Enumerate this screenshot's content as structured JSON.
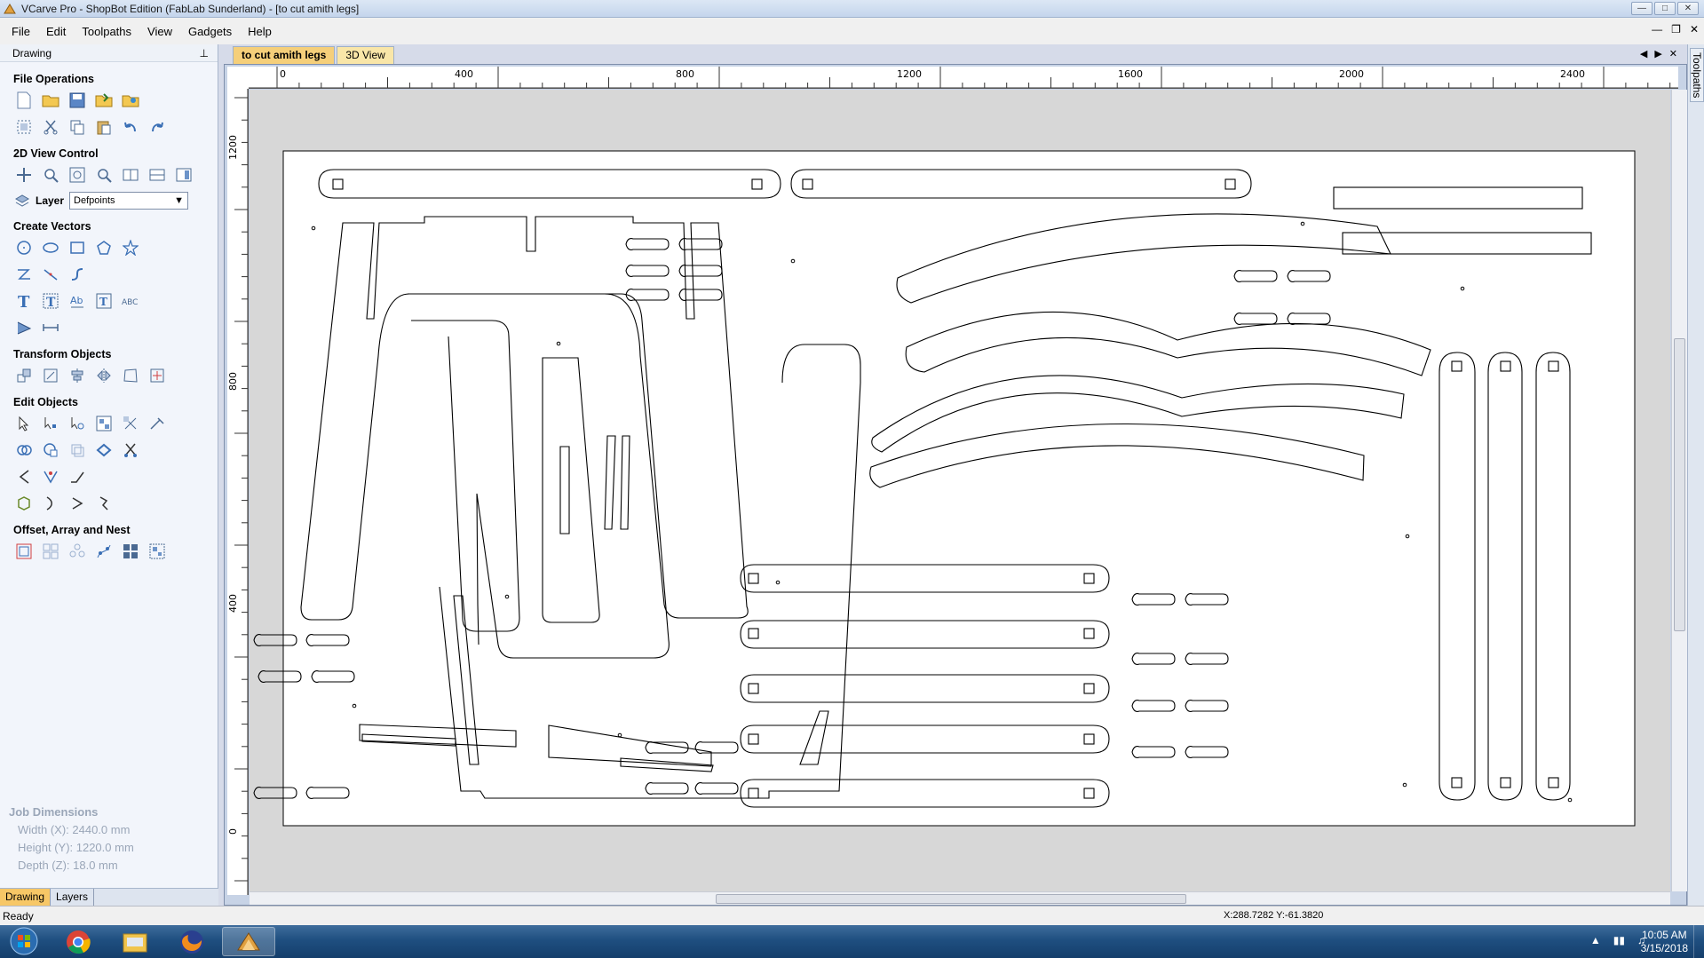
{
  "window": {
    "title": "VCarve Pro - ShopBot Edition (FabLab Sunderland) - [to cut amith legs]",
    "controls": [
      "minimize",
      "maximize",
      "close"
    ]
  },
  "menu": [
    "File",
    "Edit",
    "Toolpaths",
    "View",
    "Gadgets",
    "Help"
  ],
  "left_panel": {
    "header": "Drawing",
    "sections": {
      "file_operations": "File Operations",
      "view_control": "2D View Control",
      "create_vectors": "Create Vectors",
      "transform_objects": "Transform Objects",
      "edit_objects": "Edit Objects",
      "offset_array_nest": "Offset, Array and Nest"
    },
    "layer_label": "Layer",
    "layer_value": "Defpoints",
    "job_dimensions": {
      "title": "Job Dimensions",
      "width": "Width  (X): 2440.0 mm",
      "height": "Height (Y): 1220.0 mm",
      "depth": "Depth  (Z): 18.0 mm"
    },
    "tabs": [
      "Drawing",
      "Layers"
    ]
  },
  "doc_tabs": [
    "to cut amith legs",
    "3D View"
  ],
  "right_strip": {
    "label": "Toolpaths"
  },
  "rulers": {
    "h_labels": [
      "0",
      "400",
      "800",
      "1200",
      "1600",
      "2000",
      "2400"
    ],
    "v_labels": [
      "1200",
      "800",
      "400",
      "0"
    ]
  },
  "status": {
    "text": "Ready",
    "coords": "X:288.7282 Y:-61.3820"
  },
  "taskbar": {
    "apps": [
      "start",
      "chrome",
      "file-explorer",
      "firefox",
      "vcarve"
    ],
    "time": "10:05 AM",
    "date": "3/15/2018"
  },
  "colors": {
    "accent": "#f5cf7a",
    "canvas_bg": "#d7d7d7",
    "sheet": "#ffffff",
    "vector": "#000000"
  }
}
